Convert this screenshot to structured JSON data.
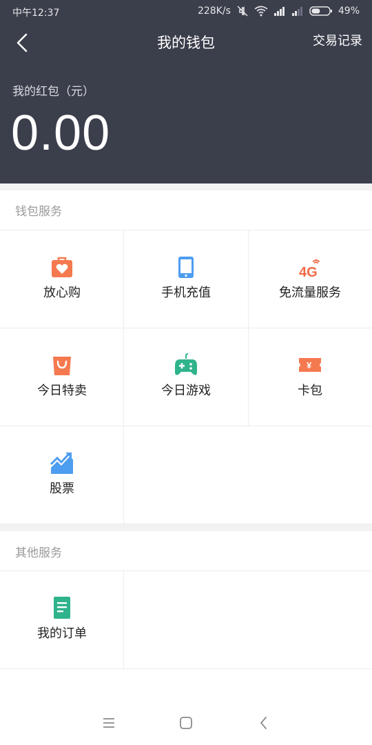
{
  "status_bar": {
    "time": "中午12:37",
    "net_speed": "228K/s",
    "battery": "49%",
    "battery_level": 0.49
  },
  "nav": {
    "title": "我的钱包",
    "right_link": "交易记录"
  },
  "balance": {
    "label": "我的红包（元）",
    "value": "0.00"
  },
  "wallet_section": {
    "title": "钱包服务",
    "items": [
      {
        "label": "放心购",
        "icon": "heart-bag-icon",
        "color": "#f5794f"
      },
      {
        "label": "手机充值",
        "icon": "phone-icon",
        "color": "#4d9df0"
      },
      {
        "label": "免流量服务",
        "icon": "4g-icon",
        "color": "#f06a45",
        "icon_text": "4G"
      },
      {
        "label": "今日特卖",
        "icon": "shopping-bag-icon",
        "color": "#f5794f"
      },
      {
        "label": "今日游戏",
        "icon": "gamepad-icon",
        "color": "#2fb38c"
      },
      {
        "label": "卡包",
        "icon": "ticket-icon",
        "color": "#f5794f",
        "icon_text": "¥"
      },
      {
        "label": "股票",
        "icon": "stock-chart-icon",
        "color": "#4d9df0"
      }
    ]
  },
  "other_section": {
    "title": "其他服务",
    "items": [
      {
        "label": "我的订单",
        "icon": "document-icon",
        "color": "#2fb38c"
      }
    ]
  },
  "colors": {
    "header_bg": "#3b3e4b",
    "divider": "#ececec",
    "section_gap": "#f2f2f2"
  }
}
